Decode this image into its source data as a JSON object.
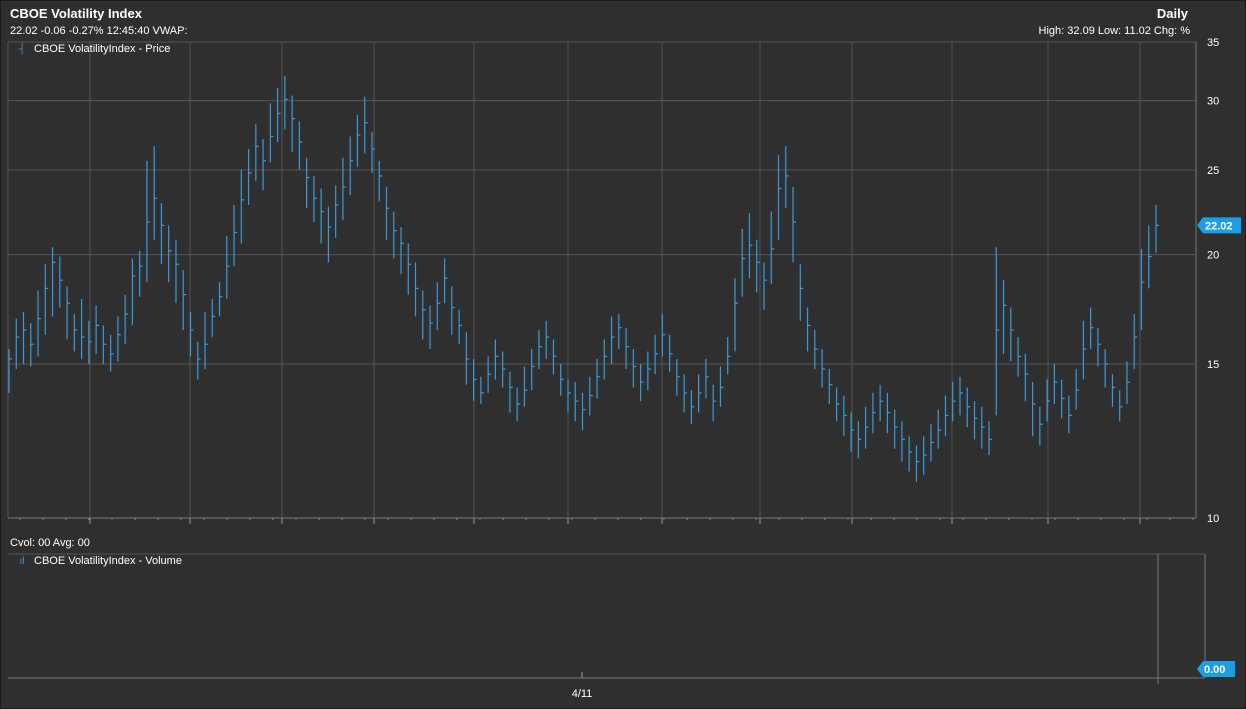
{
  "header": {
    "title": "CBOE Volatility Index",
    "period": "Daily",
    "quote": "22.02 -0.06 -0.27% 12:45:40 VWAP:",
    "range": "High: 32.09 Low: 11.02 Chg: %"
  },
  "volume_panel": {
    "cvol": "Cvol: 00 Avg: 00"
  },
  "colors": {
    "series": "#3a9ad9",
    "badge": "#1a9ee6",
    "grid": "#555555",
    "background": "#2f2f2f"
  },
  "chart_data": [
    {
      "type": "ohlc",
      "legend": "CBOE VolatilityIndex - Price",
      "y_scale": "log",
      "ylim": [
        10,
        35
      ],
      "y_ticks": [
        10,
        15,
        20,
        25,
        30,
        35
      ],
      "last_value_label": "22.02",
      "x_tick_label": "4/11",
      "values": [
        [
          15.2,
          13.9,
          15.6
        ],
        [
          16.1,
          14.8,
          16.9
        ],
        [
          16.4,
          15.0,
          17.2
        ],
        [
          15.8,
          14.9,
          16.7
        ],
        [
          16.9,
          15.3,
          18.2
        ],
        [
          18.3,
          16.2,
          19.5
        ],
        [
          19.6,
          17.0,
          20.4
        ],
        [
          18.7,
          17.4,
          19.9
        ],
        [
          17.6,
          16.0,
          18.4
        ],
        [
          16.4,
          15.5,
          17.1
        ],
        [
          16.1,
          15.2,
          17.8
        ],
        [
          15.9,
          15.0,
          16.8
        ],
        [
          16.6,
          15.4,
          17.5
        ],
        [
          15.8,
          15.0,
          16.6
        ],
        [
          15.4,
          14.7,
          16.2
        ],
        [
          16.2,
          15.1,
          17.0
        ],
        [
          17.1,
          15.8,
          18.0
        ],
        [
          18.9,
          16.6,
          19.8
        ],
        [
          19.4,
          17.9,
          20.2
        ],
        [
          21.8,
          18.6,
          25.6
        ],
        [
          23.2,
          20.8,
          26.6
        ],
        [
          21.6,
          19.5,
          22.9
        ],
        [
          20.2,
          18.6,
          21.6
        ],
        [
          19.5,
          17.6,
          20.8
        ],
        [
          18.0,
          16.4,
          19.2
        ],
        [
          16.4,
          15.3,
          17.2
        ],
        [
          15.2,
          14.4,
          15.9
        ],
        [
          15.8,
          14.8,
          17.2
        ],
        [
          17.0,
          16.1,
          17.8
        ],
        [
          17.9,
          17.0,
          18.6
        ],
        [
          19.4,
          17.8,
          21.0
        ],
        [
          21.2,
          19.4,
          22.8
        ],
        [
          23.1,
          20.6,
          25.0
        ],
        [
          24.8,
          22.8,
          26.4
        ],
        [
          26.6,
          24.3,
          28.2
        ],
        [
          25.6,
          23.7,
          27.1
        ],
        [
          27.3,
          25.5,
          29.8
        ],
        [
          29.0,
          26.9,
          31.0
        ],
        [
          30.1,
          27.8,
          32.0
        ],
        [
          28.6,
          26.2,
          30.4
        ],
        [
          26.9,
          25.0,
          28.4
        ],
        [
          24.5,
          22.6,
          25.8
        ],
        [
          23.2,
          21.8,
          24.6
        ],
        [
          22.4,
          20.6,
          23.8
        ],
        [
          21.5,
          19.6,
          22.7
        ],
        [
          22.8,
          20.9,
          24.0
        ],
        [
          23.9,
          21.9,
          25.8
        ],
        [
          25.6,
          23.4,
          27.3
        ],
        [
          27.4,
          25.2,
          28.9
        ],
        [
          28.3,
          26.1,
          30.3
        ],
        [
          26.4,
          24.8,
          27.6
        ],
        [
          24.6,
          23.0,
          25.6
        ],
        [
          22.6,
          20.8,
          23.9
        ],
        [
          21.3,
          19.8,
          22.4
        ],
        [
          20.6,
          19.0,
          21.5
        ],
        [
          19.5,
          18.0,
          20.6
        ],
        [
          18.3,
          17.0,
          19.6
        ],
        [
          17.3,
          16.0,
          18.2
        ],
        [
          16.7,
          15.6,
          17.5
        ],
        [
          17.6,
          16.4,
          18.6
        ],
        [
          18.8,
          17.6,
          19.8
        ],
        [
          17.4,
          16.2,
          18.4
        ],
        [
          16.6,
          15.8,
          17.3
        ],
        [
          15.2,
          14.2,
          16.3
        ],
        [
          14.4,
          13.6,
          15.2
        ],
        [
          13.9,
          13.5,
          14.5
        ],
        [
          14.6,
          13.9,
          15.3
        ],
        [
          15.3,
          14.4,
          16.0
        ],
        [
          14.8,
          14.1,
          15.5
        ],
        [
          14.1,
          13.2,
          14.7
        ],
        [
          13.5,
          12.9,
          14.1
        ],
        [
          14.0,
          13.4,
          14.9
        ],
        [
          14.9,
          14.0,
          15.6
        ],
        [
          15.7,
          14.8,
          16.4
        ],
        [
          16.1,
          15.2,
          16.8
        ],
        [
          15.3,
          14.6,
          16.0
        ],
        [
          14.4,
          13.8,
          15.0
        ],
        [
          13.9,
          13.2,
          14.4
        ],
        [
          13.6,
          12.9,
          14.3
        ],
        [
          13.3,
          12.6,
          13.9
        ],
        [
          13.8,
          13.1,
          14.5
        ],
        [
          14.5,
          13.7,
          15.2
        ],
        [
          15.3,
          14.4,
          16.0
        ],
        [
          16.1,
          15.0,
          17.0
        ],
        [
          16.5,
          15.6,
          17.1
        ],
        [
          15.7,
          14.8,
          16.5
        ],
        [
          14.9,
          14.1,
          15.6
        ],
        [
          14.3,
          13.6,
          15.0
        ],
        [
          14.8,
          14.0,
          15.5
        ],
        [
          15.4,
          14.6,
          16.2
        ],
        [
          16.2,
          15.3,
          17.1
        ],
        [
          15.4,
          14.7,
          16.2
        ],
        [
          14.5,
          13.8,
          15.2
        ],
        [
          13.9,
          13.2,
          14.6
        ],
        [
          13.4,
          12.8,
          14.0
        ],
        [
          13.9,
          13.2,
          14.6
        ],
        [
          14.5,
          13.7,
          15.2
        ],
        [
          13.6,
          12.9,
          14.2
        ],
        [
          14.1,
          13.4,
          14.9
        ],
        [
          15.3,
          14.6,
          16.1
        ],
        [
          17.6,
          15.5,
          18.8
        ],
        [
          19.8,
          17.9,
          21.4
        ],
        [
          20.5,
          18.8,
          22.3
        ],
        [
          19.6,
          18.1,
          20.8
        ],
        [
          18.7,
          17.3,
          19.6
        ],
        [
          20.3,
          18.5,
          22.4
        ],
        [
          23.8,
          20.8,
          26.0
        ],
        [
          24.6,
          22.6,
          26.6
        ],
        [
          21.8,
          19.6,
          23.9
        ],
        [
          18.3,
          16.8,
          19.5
        ],
        [
          16.6,
          15.5,
          17.4
        ],
        [
          15.6,
          14.8,
          16.4
        ],
        [
          14.8,
          14.1,
          15.6
        ],
        [
          14.2,
          13.5,
          14.8
        ],
        [
          13.5,
          12.9,
          14.1
        ],
        [
          13.1,
          12.4,
          13.8
        ],
        [
          12.6,
          11.9,
          13.2
        ],
        [
          12.3,
          11.7,
          12.9
        ],
        [
          12.7,
          12.0,
          13.4
        ],
        [
          13.2,
          12.5,
          13.9
        ],
        [
          13.6,
          12.9,
          14.2
        ],
        [
          13.2,
          12.5,
          13.9
        ],
        [
          12.7,
          12.0,
          13.3
        ],
        [
          12.3,
          11.6,
          12.9
        ],
        [
          11.9,
          11.3,
          12.4
        ],
        [
          11.6,
          11.0,
          12.1
        ],
        [
          11.8,
          11.2,
          12.4
        ],
        [
          12.2,
          11.6,
          12.8
        ],
        [
          12.6,
          12.0,
          13.3
        ],
        [
          13.1,
          12.4,
          13.8
        ],
        [
          13.6,
          12.9,
          14.3
        ],
        [
          13.9,
          13.1,
          14.5
        ],
        [
          13.4,
          12.7,
          14.1
        ],
        [
          13.0,
          12.3,
          13.6
        ],
        [
          12.7,
          12.0,
          13.4
        ],
        [
          12.3,
          11.8,
          12.9
        ],
        [
          16.4,
          13.1,
          20.4
        ],
        [
          17.5,
          15.4,
          18.7
        ],
        [
          16.4,
          15.1,
          17.4
        ],
        [
          15.3,
          14.5,
          16.1
        ],
        [
          14.6,
          13.6,
          15.4
        ],
        [
          13.5,
          12.4,
          14.3
        ],
        [
          12.8,
          12.1,
          13.4
        ],
        [
          13.6,
          12.9,
          14.4
        ],
        [
          14.3,
          13.5,
          15.0
        ],
        [
          13.7,
          13.0,
          14.4
        ],
        [
          13.1,
          12.5,
          13.8
        ],
        [
          14.0,
          13.3,
          14.8
        ],
        [
          15.6,
          14.4,
          16.8
        ],
        [
          16.5,
          15.6,
          17.4
        ],
        [
          15.8,
          14.9,
          16.5
        ],
        [
          15.0,
          14.1,
          15.6
        ],
        [
          14.1,
          13.4,
          14.6
        ],
        [
          13.4,
          12.9,
          14.0
        ],
        [
          14.3,
          13.5,
          15.1
        ],
        [
          16.1,
          14.8,
          17.1
        ],
        [
          18.6,
          16.4,
          20.3
        ],
        [
          19.9,
          18.3,
          21.6
        ],
        [
          21.6,
          20.1,
          22.8
        ]
      ]
    },
    {
      "type": "bar",
      "legend": "CBOE VolatilityIndex - Volume",
      "last_value_label": "0.00"
    }
  ]
}
